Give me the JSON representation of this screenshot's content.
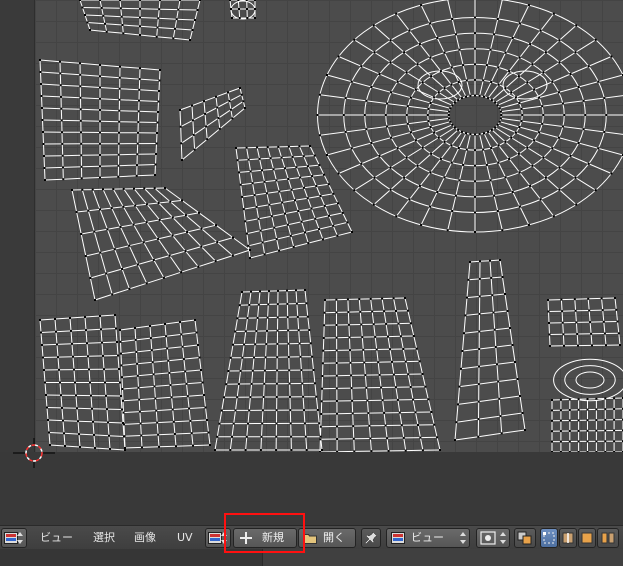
{
  "header": {
    "menus": [
      {
        "label": "ビュー"
      },
      {
        "label": "選択"
      },
      {
        "label": "画像"
      },
      {
        "label": "UV"
      }
    ],
    "new_label": "新規",
    "open_label": "開く",
    "view_mode": "ビュー"
  },
  "icons": {
    "editor_type": "image-editor-icon",
    "new": "plus-icon",
    "open": "folder-icon",
    "pin": "pin-icon",
    "pivot": "pivot-icon",
    "sync": "uv-sync-icon",
    "select_modes": [
      "vertex-select-icon",
      "edge-select-icon",
      "face-select-icon",
      "island-select-icon"
    ]
  },
  "colors": {
    "highlight": "#ff1010",
    "header_bg": "#444444",
    "grid_bg": "#4c4c4c",
    "uv_edge": "#ffffff",
    "uv_vertex": "#000000"
  }
}
